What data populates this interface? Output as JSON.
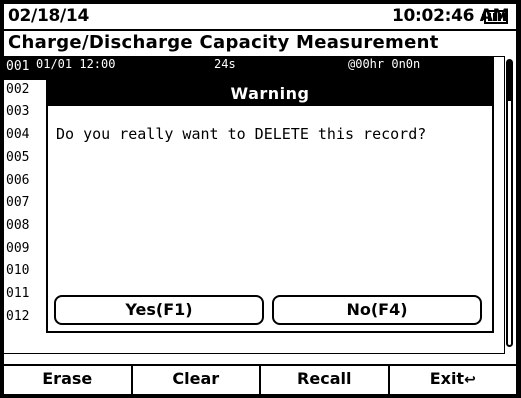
{
  "status": {
    "date": "02/18/14",
    "time": "10:02:46 AM",
    "battery_icon": "battery-full-icon"
  },
  "title": "Charge/Discharge Capacity Measurement",
  "list": {
    "rows": [
      "001",
      "002",
      "003",
      "004",
      "005",
      "006",
      "007",
      "008",
      "009",
      "010",
      "011",
      "012"
    ],
    "selected_row_fragments": {
      "date": "01/01 12:00",
      "duration": "24s",
      "value": "@00hr 0n0n"
    }
  },
  "dialog": {
    "title": "Warning",
    "message": "Do you really want to DELETE this record?",
    "yes_label": "Yes(F1)",
    "no_label": "No(F4)"
  },
  "function_keys": {
    "f1": "Erase",
    "f2": "Clear",
    "f3": "Recall",
    "f4": "Exit",
    "f4_icon": "return-arrow-icon"
  }
}
